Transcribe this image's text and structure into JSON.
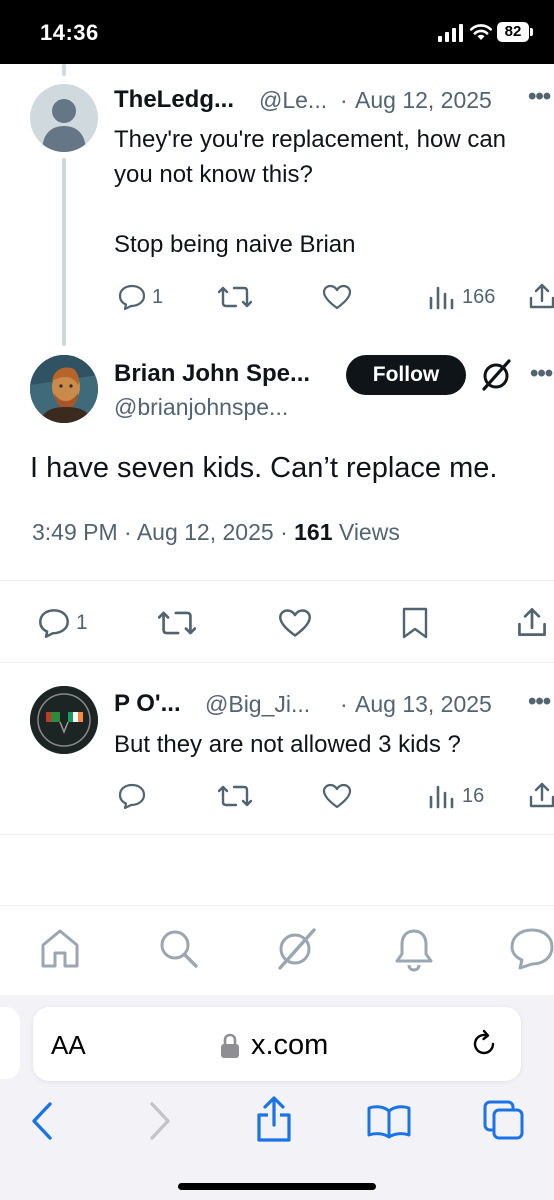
{
  "status_bar": {
    "time": "14:36",
    "battery": "82"
  },
  "reply_1": {
    "name": "TheLedg...",
    "handle": "@Le...",
    "separator": "·",
    "date": "Aug 12, 2025",
    "text_line1": "They're you're replacement, how can",
    "text_line2": "you not know this?",
    "text_line3": "Stop being naive Brian",
    "replies": "1",
    "views": "166"
  },
  "main_tweet": {
    "name": "Brian John Spe...",
    "handle": "@brianjohnspe...",
    "follow_label": "Follow",
    "text": "I have seven kids. Can’t replace me.",
    "time": "3:49 PM",
    "date": "Aug 12, 2025",
    "views_count": "161",
    "views_label": "Views",
    "replies": "1"
  },
  "reply_2": {
    "name": "P O'...",
    "handle": "@Big_Ji...",
    "separator": "·",
    "date": "Aug 13, 2025",
    "text": "But they are not allowed 3 kids ?",
    "views": "16"
  },
  "bottom_nav": {
    "icons": [
      "home-icon",
      "search-icon",
      "grok-icon",
      "notifications-icon",
      "messages-icon"
    ]
  },
  "safari": {
    "aa_label": "AA",
    "url": "x.com"
  },
  "colors": {
    "text": "#0f1419",
    "secondary": "#536471",
    "accent_blue": "#1a73e8",
    "thread_line": "#cfd9de"
  }
}
